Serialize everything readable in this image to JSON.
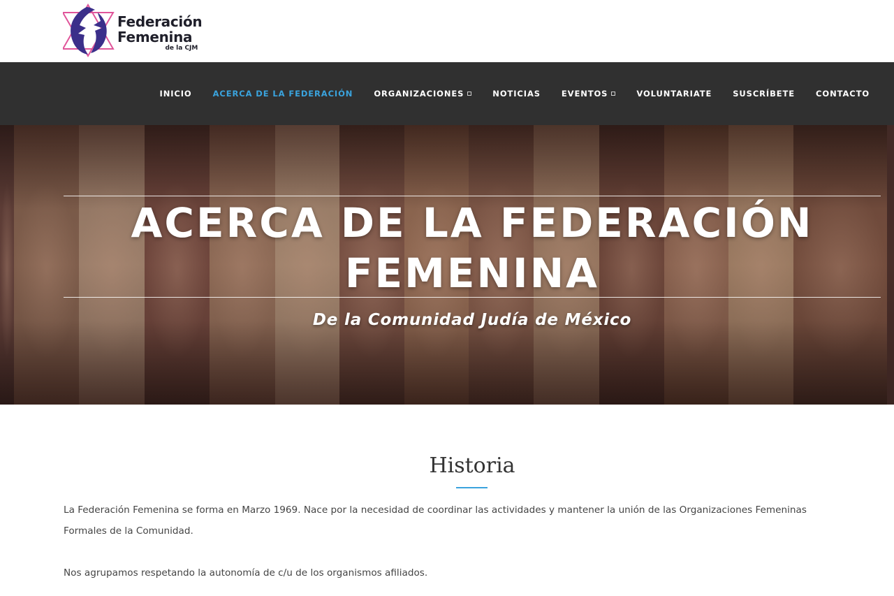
{
  "logo": {
    "line1": "Federación",
    "line2": "Femenina",
    "line3": "de la CJM",
    "colors": {
      "purple": "#3b2f8a",
      "pink": "#e0559a",
      "text": "#1f1f2a"
    }
  },
  "nav": {
    "items": [
      {
        "label": "INICIO",
        "active": false,
        "dropdown": false
      },
      {
        "label": "ACERCA DE LA FEDERACIÓN",
        "active": true,
        "dropdown": false
      },
      {
        "label": "ORGANIZACIONES",
        "active": false,
        "dropdown": true
      },
      {
        "label": "NOTICIAS",
        "active": false,
        "dropdown": false
      },
      {
        "label": "EVENTOS",
        "active": false,
        "dropdown": true
      },
      {
        "label": "VOLUNTARIATE",
        "active": false,
        "dropdown": false
      },
      {
        "label": "SUSCRÍBETE",
        "active": false,
        "dropdown": false
      },
      {
        "label": "CONTACTO",
        "active": false,
        "dropdown": false
      }
    ],
    "active_color": "#3aa3dd",
    "background": "#303030"
  },
  "hero": {
    "title": "ACERCA DE LA FEDERACIÓN FEMENINA",
    "subtitle": "De la Comunidad Judía de México"
  },
  "main": {
    "section_title": "Historia",
    "paragraphs": [
      "La Federación Femenina se forma en Marzo 1969. Nace por la necesidad de coordinar las actividades y mantener la unión de las Organizaciones Femeninas Formales de la Comunidad.",
      "Nos agrupamos respetando la autonomía de c/u de los organismos afiliados."
    ]
  }
}
